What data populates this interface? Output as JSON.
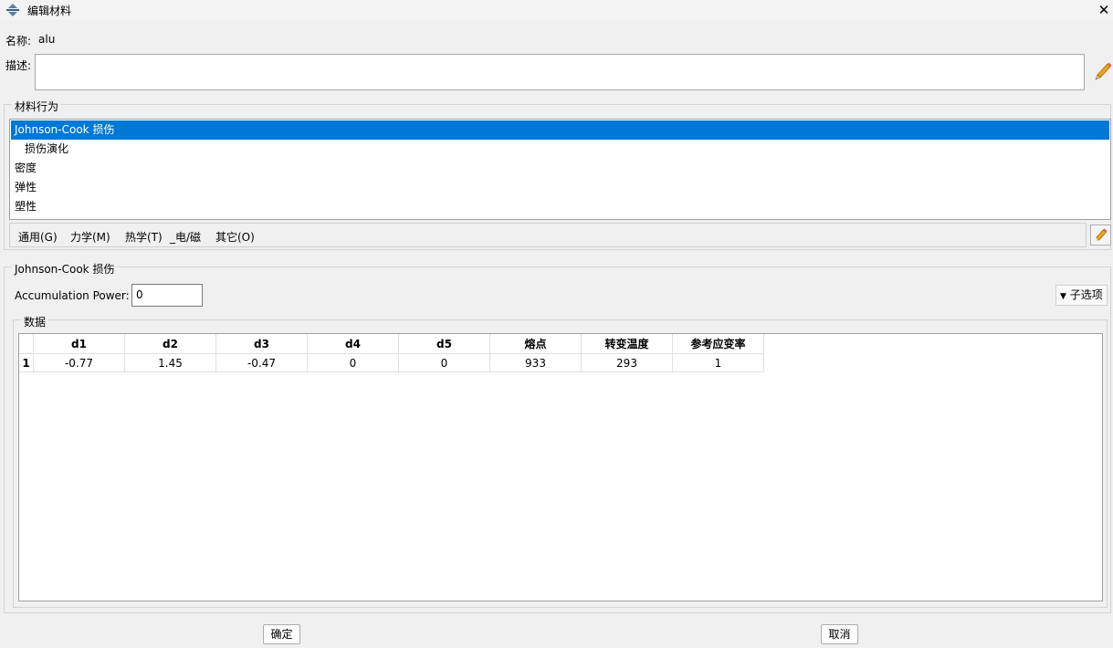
{
  "window": {
    "title": "编辑材料",
    "close_glyph": "✕"
  },
  "name_row": {
    "label": "名称:",
    "value": "alu"
  },
  "description": {
    "label": "描述:",
    "value": ""
  },
  "behavior_group": {
    "title": "材料行为",
    "items": [
      "Johnson-Cook 损伤",
      "损伤演化",
      "密度",
      "弹性",
      "塑性"
    ],
    "selected_index": 0
  },
  "menus": [
    "通用(G)",
    "力学(M)",
    "热学(T)",
    "_电/磁",
    "其它(O)"
  ],
  "section": {
    "title": "Johnson-Cook 损伤",
    "accumulation_label": "Accumulation Power:",
    "accumulation_value": "0",
    "suboptions_label": "子选项"
  },
  "data_group": {
    "title": "数据",
    "columns": [
      "d1",
      "d2",
      "d3",
      "d4",
      "d5",
      "熔点",
      "转变温度",
      "参考应变率"
    ],
    "rows": [
      {
        "index": "1",
        "cells": [
          "-0.77",
          "1.45",
          "-0.47",
          "0",
          "0",
          "933",
          "293",
          "1"
        ]
      }
    ]
  },
  "buttons": {
    "ok": "确定",
    "cancel": "取消"
  },
  "colors": {
    "selection": "#0078d7",
    "pencil": "#f2a21c"
  }
}
